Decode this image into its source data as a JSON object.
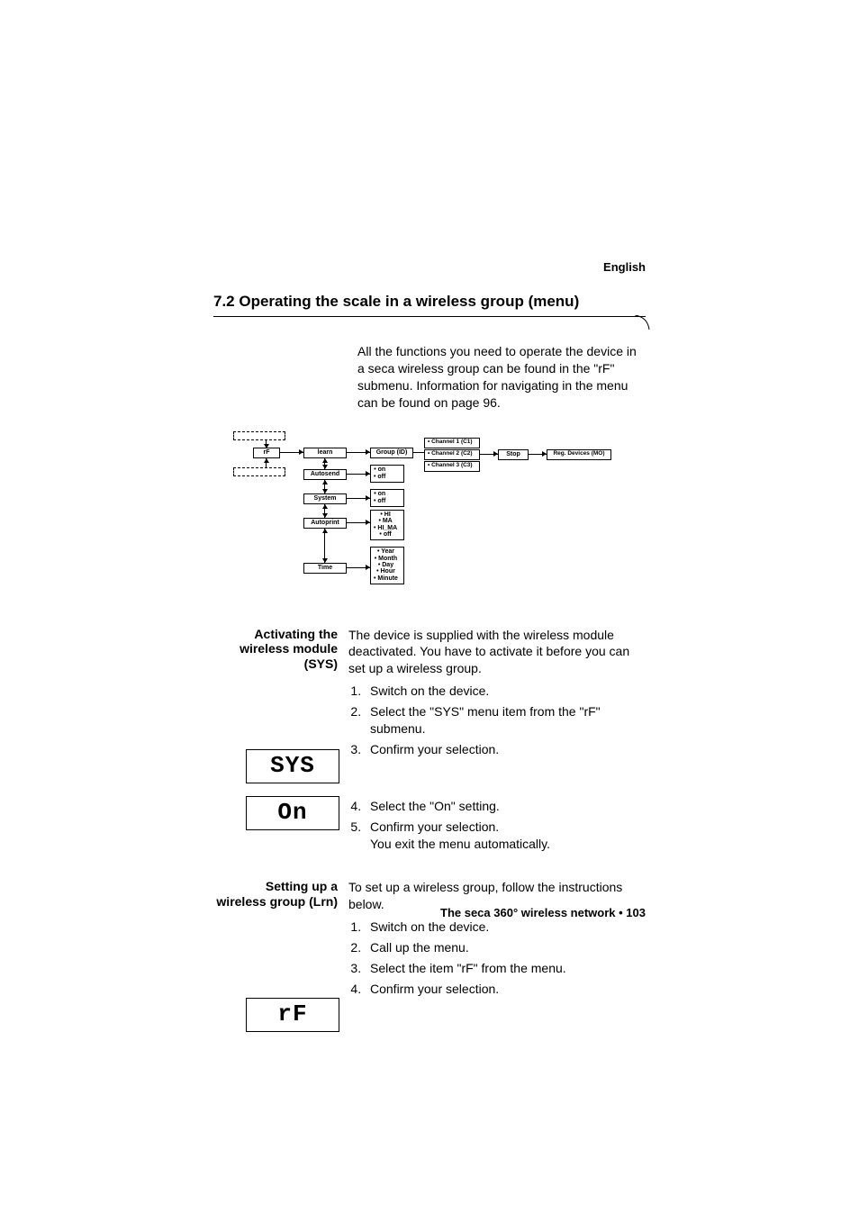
{
  "lang": "English",
  "section_title": "7.2  Operating the scale in a wireless group (menu)",
  "intro": "All the functions you need to operate the device in a seca  wireless group can be found in the \"rF\" submenu. Information for navigating in the menu can be found on page 96.",
  "diagram": {
    "rf": "rF",
    "learn": "learn",
    "autosend": "Autosend",
    "system": "System",
    "autoprint": "Autoprint",
    "time": "Time",
    "group": "Group (ID)",
    "onoff1": "• on\n• off",
    "onoff2": "• on\n• off",
    "printopts": "• HI\n• MA\n• HI_MA\n• off",
    "timeopts": "• Year\n• Month\n• Day\n• Hour\n• Minute",
    "c1": "• Channel 1 (C1)",
    "c2": "• Channel 2 (C2)",
    "c3": "• Channel 3 (C3)",
    "stop": "Stop",
    "reg": "Reg. Devices (MO)"
  },
  "sys": {
    "heading": "Activating the wireless module (SYS)",
    "intro": "The device is supplied with the wireless module deactivated. You have to activate it before you can set up a wireless group.",
    "steps_a": {
      "s1": "Switch on the device.",
      "s2": "Select the \"SYS\" menu item from the \"rF\" submenu.",
      "s3": "Confirm your selection."
    },
    "steps_b": {
      "s4": "Select the \"On\" setting.",
      "s5": "Confirm your selection.",
      "s5b": "You exit the menu automatically."
    },
    "disp1": "SYS",
    "disp2": "On"
  },
  "lrn": {
    "heading": "Setting up a wireless group (Lrn)",
    "intro": "To set up a wireless group, follow the instructions below.",
    "steps": {
      "s1": "Switch on the device.",
      "s2": "Call up the menu.",
      "s3": "Select the item \"rF\" from the menu.",
      "s4": "Confirm your selection."
    },
    "disp": "rF"
  },
  "footer": "The seca 360° wireless network • 103"
}
